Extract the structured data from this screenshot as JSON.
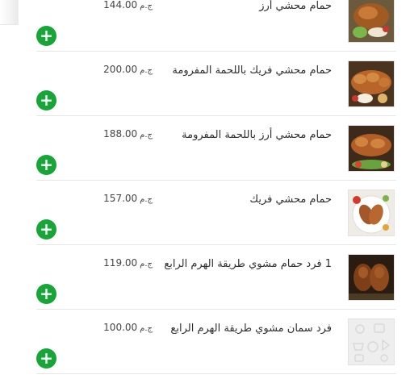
{
  "menu": {
    "currency": "ج.م",
    "items": [
      {
        "name": "حمام محشي أرز",
        "price": "144.00",
        "image_icon": "stuffed-pigeon-rice-photo",
        "add_icon": "plus-icon"
      },
      {
        "name": "حمام محشي فريك باللحمة المفرومة",
        "price": "200.00",
        "image_icon": "stuffed-pigeon-freekeh-minced-meat-photo",
        "add_icon": "plus-icon"
      },
      {
        "name": "حمام محشي أرز باللحمة المفرومة",
        "price": "188.00",
        "image_icon": "stuffed-pigeon-rice-minced-meat-photo",
        "add_icon": "plus-icon"
      },
      {
        "name": "حمام محشي فريك",
        "price": "157.00",
        "image_icon": "stuffed-pigeon-freekeh-photo",
        "add_icon": "plus-icon"
      },
      {
        "name": "1 فرد حمام مشوي طريقة الهرم الرابع",
        "price": "119.00",
        "image_icon": "grilled-pigeon-photo",
        "add_icon": "plus-icon"
      },
      {
        "name": "فرد سمان مشوي طريقة الهرم الرابع",
        "price": "100.00",
        "image_icon": "placeholder-image-icon",
        "add_icon": "plus-icon"
      }
    ]
  },
  "colors": {
    "add_button": "#16a536",
    "divider": "#e6e6e6",
    "text": "#2f2f2f"
  }
}
